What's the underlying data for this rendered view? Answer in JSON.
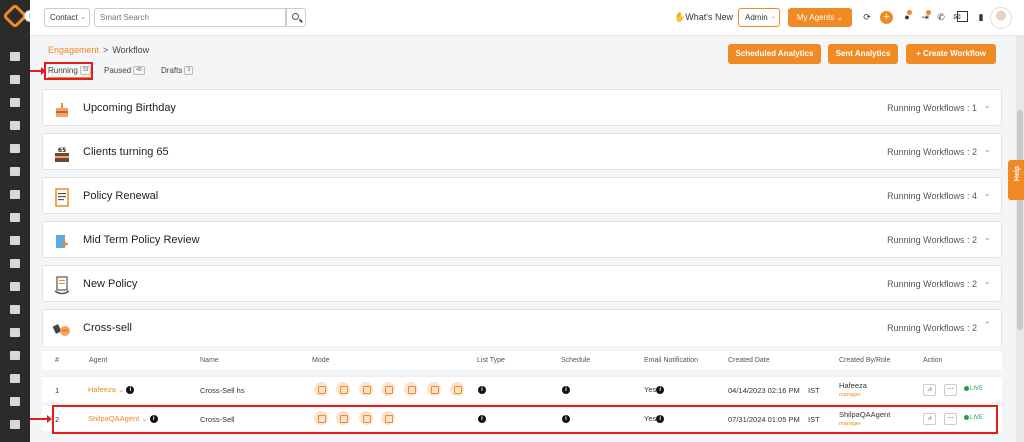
{
  "topbar": {
    "contact_select": "Contact",
    "search_placeholder": "Smart Search",
    "whats_new": "What's New",
    "admin_select": "Admin",
    "my_agents": "My Agents"
  },
  "breadcrumb": {
    "root": "Engagement",
    "separator": ">",
    "current": "Workflow"
  },
  "tabs": [
    {
      "label": "Running",
      "count": "33"
    },
    {
      "label": "Paused",
      "count": "48"
    },
    {
      "label": "Drafts",
      "count": "3"
    }
  ],
  "actions": {
    "scheduled": "Scheduled Analytics",
    "sent": "Sent Analytics",
    "create": "+ Create Workflow"
  },
  "help_label": "Help",
  "workflows": [
    {
      "title": "Upcoming Birthday",
      "count": "Running Workflows : 1",
      "icon": "cake-icon"
    },
    {
      "title": "Clients turning 65",
      "count": "Running Workflows : 2",
      "icon": "cake-65-icon"
    },
    {
      "title": "Policy Renewal",
      "count": "Running Workflows : 4",
      "icon": "document-icon"
    },
    {
      "title": "Mid Term Policy Review",
      "count": "Running Workflows : 2",
      "icon": "review-icon"
    },
    {
      "title": "New Policy",
      "count": "Running Workflows : 2",
      "icon": "new-policy-icon"
    },
    {
      "title": "Cross-sell",
      "count": "Running Workflows : 2",
      "icon": "handshake-icon"
    }
  ],
  "table": {
    "headers": [
      "#",
      "Agent",
      "Name",
      "Mode",
      "List Type",
      "Schedule",
      "Email Notification",
      "Created Date",
      "Created By/Role",
      "Action"
    ],
    "rows": [
      {
        "num": "1",
        "agent": "Hafeeza",
        "name": "Cross-Sell hs",
        "email": "Yes",
        "date": "04/14/2023 02:16 PM",
        "tz": "IST",
        "creator": "Hafeeza",
        "role": "manager",
        "status": "LIVE"
      },
      {
        "num": "2",
        "agent": "ShilpaQAAgent",
        "name": "Cross-Sell",
        "email": "Yes",
        "date": "07/31/2024 01:05 PM",
        "tz": "IST",
        "creator": "ShilpaQAAgent",
        "role": "manager",
        "status": "LIVE"
      }
    ]
  },
  "colors": {
    "accent": "#f08a24",
    "annotation_red": "#e31c1c",
    "live_green": "#1aa049"
  }
}
